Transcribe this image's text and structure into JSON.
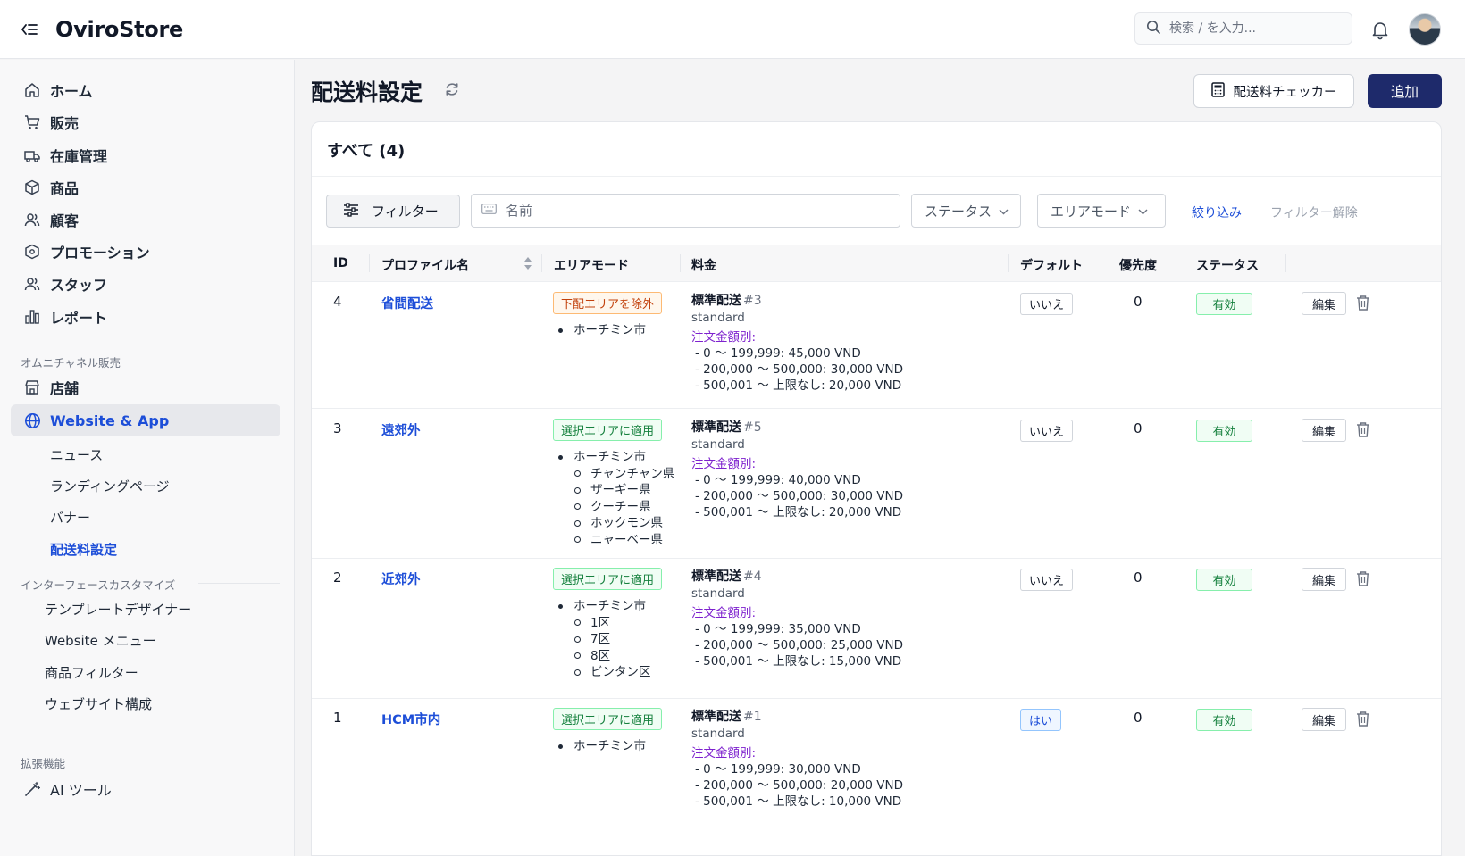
{
  "header": {
    "brand": "OviroStore",
    "search_placeholder": "検索 / を入力...",
    "icons": {
      "collapse": "collapse-menu-icon",
      "search": "search-icon",
      "bell": "bell-icon",
      "avatar": "avatar"
    }
  },
  "sidebar": {
    "main_items": [
      {
        "label": "ホーム",
        "icon": "home-icon"
      },
      {
        "label": "販売",
        "icon": "cart-icon"
      },
      {
        "label": "在庫管理",
        "icon": "truck-icon"
      },
      {
        "label": "商品",
        "icon": "box-icon"
      },
      {
        "label": "顧客",
        "icon": "users-icon"
      },
      {
        "label": "プロモーション",
        "icon": "tag-icon"
      },
      {
        "label": "スタッフ",
        "icon": "staff-icon"
      },
      {
        "label": "レポート",
        "icon": "bar-chart-icon"
      }
    ],
    "omni_section_label": "オムニチャネル販売",
    "omni_items": [
      {
        "label": "店舗",
        "icon": "store-icon"
      },
      {
        "label": "Website & App",
        "icon": "globe-icon",
        "active": true
      }
    ],
    "website_sub_items": [
      {
        "label": "ニュース"
      },
      {
        "label": "ランディングページ"
      },
      {
        "label": "バナー"
      },
      {
        "label": "配送料設定",
        "active": true
      }
    ],
    "interface_section_label": "インターフェースカスタマイズ",
    "interface_items": [
      {
        "label": "テンプレートデザイナー"
      },
      {
        "label": "Website メニュー"
      },
      {
        "label": "商品フィルター"
      },
      {
        "label": "ウェブサイト構成"
      }
    ],
    "extension_section_label": "拡張機能",
    "extension_items": [
      {
        "label": "AI ツール",
        "icon": "magic-wand-icon"
      }
    ]
  },
  "main": {
    "title": "配送料設定",
    "checker_button": "配送料チェッカー",
    "add_button": "追加",
    "card_title": "すべて (4)",
    "filters": {
      "filter_button": "フィルター",
      "name_placeholder": "名前",
      "status_dropdown": "ステータス",
      "area_mode_dropdown": "エリアモード",
      "apply_link": "絞り込み",
      "clear_link": "フィルター解除"
    },
    "table": {
      "headers": {
        "id": "ID",
        "profile_name": "プロファイル名",
        "area_mode": "エリアモード",
        "rate": "料金",
        "default": "デフォルト",
        "priority": "優先度",
        "status": "ステータス"
      },
      "edit_label": "編集",
      "rate_type_label": "注文金額別:",
      "rows": [
        {
          "id": "4",
          "name": "省間配送",
          "area_tag": "下配エリアを除外",
          "area_tag_color": "#c2410c",
          "areas": [
            {
              "city": "ホーチミン市",
              "districts": []
            }
          ],
          "rate_name": "標準配送",
          "rate_num": "#3",
          "rate_code": "standard",
          "tiers": [
            "- 0 ～ 199,999: 45,000 VND",
            "- 200,000 ～ 500,000: 30,000 VND",
            "- 500,001 ～ 上限なし: 20,000 VND"
          ],
          "default": "いいえ",
          "priority": "0",
          "status": "有効"
        },
        {
          "id": "3",
          "name": "遠郊外",
          "area_tag": "選択エリアに適用",
          "area_tag_color": "#15803d",
          "areas": [
            {
              "city": "ホーチミン市",
              "districts": [
                "チャンチャン県",
                "ザーギー県",
                "クーチー県",
                "ホックモン県",
                "ニャーベー県"
              ]
            }
          ],
          "rate_name": "標準配送",
          "rate_num": "#5",
          "rate_code": "standard",
          "tiers": [
            "- 0 ～ 199,999: 40,000 VND",
            "- 200,000 ～ 500,000: 30,000 VND",
            "- 500,001 ～ 上限なし: 20,000 VND"
          ],
          "default": "いいえ",
          "priority": "0",
          "status": "有効"
        },
        {
          "id": "2",
          "name": "近郊外",
          "area_tag": "選択エリアに適用",
          "area_tag_color": "#15803d",
          "areas": [
            {
              "city": "ホーチミン市",
              "districts": [
                "1区",
                "7区",
                "8区",
                "ビンタン区"
              ]
            }
          ],
          "rate_name": "標準配送",
          "rate_num": "#4",
          "rate_code": "standard",
          "tiers": [
            "- 0 ～ 199,999: 35,000 VND",
            "- 200,000 ～ 500,000: 25,000 VND",
            "- 500,001 ～ 上限なし: 15,000 VND"
          ],
          "default": "いいえ",
          "priority": "0",
          "status": "有効"
        },
        {
          "id": "1",
          "name": "HCM市内",
          "area_tag": "選択エリアに適用",
          "area_tag_color": "#15803d",
          "areas": [
            {
              "city": "ホーチミン市",
              "districts": []
            }
          ],
          "rate_name": "標準配送",
          "rate_num": "#1",
          "rate_code": "standard",
          "tiers": [
            "- 0 ～ 199,999: 30,000 VND",
            "- 200,000 ～ 500,000: 20,000 VND",
            "- 500,001 ～ 上限なし: 10,000 VND"
          ],
          "default": "はい",
          "priority": "0",
          "status": "有効"
        }
      ]
    }
  },
  "colors": {
    "accent": "#1d4ed8",
    "primary_button": "#1e2a6b",
    "success": "#15803d",
    "warning": "#c2410c",
    "rate_type": "#7e22ce"
  }
}
